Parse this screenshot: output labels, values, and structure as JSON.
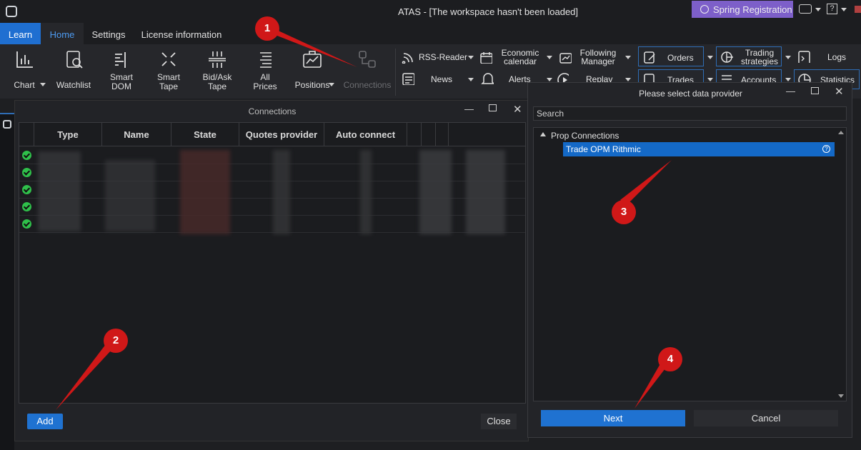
{
  "window": {
    "title": "ATAS - [The workspace hasn't been loaded]",
    "promo_button": "Spring Registration",
    "help_symbol": "?"
  },
  "menu": {
    "tabs": [
      {
        "label": "Learn"
      },
      {
        "label": "Home"
      },
      {
        "label": "Settings"
      },
      {
        "label": "License information"
      }
    ]
  },
  "ribbon": {
    "chart": "Chart",
    "watchlist": "Watchlist",
    "smart_dom": [
      "Smart",
      "DOM"
    ],
    "smart_tape": [
      "Smart",
      "Tape"
    ],
    "bidask_tape": [
      "Bid/Ask",
      "Tape"
    ],
    "all_prices": [
      "All",
      "Prices"
    ],
    "positions": "Positions",
    "connections": "Connections",
    "rss_reader": "RSS-Reader",
    "news": "News",
    "economic_calendar": [
      "Economic",
      "calendar"
    ],
    "alerts": "Alerts",
    "following_manager": [
      "Following",
      "Manager"
    ],
    "replay": "Replay",
    "orders": "Orders",
    "trades": "Trades",
    "trading_strategies": [
      "Trading",
      "strategies"
    ],
    "accounts": "Accounts",
    "logs": "Logs",
    "statistics": "Statistics"
  },
  "connections_dialog": {
    "title": "Connections",
    "columns": [
      "Type",
      "Name",
      "State",
      "Quotes provider",
      "Auto connect"
    ],
    "row_count": 5,
    "add_label": "Add",
    "close_label": "Close"
  },
  "provider_dialog": {
    "title": "Please select data provider",
    "search_placeholder": "Search",
    "group": "Prop Connections",
    "selected_item": "Trade OPM Rithmic",
    "next_label": "Next",
    "cancel_label": "Cancel"
  },
  "callouts": [
    "1",
    "2",
    "3",
    "4"
  ]
}
